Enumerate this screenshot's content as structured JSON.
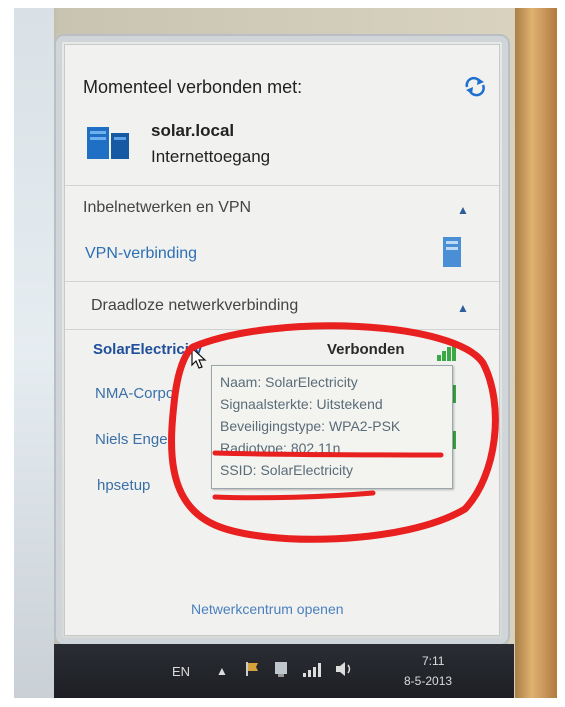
{
  "connected": {
    "heading": "Momenteel verbonden met:",
    "network_name": "solar.local",
    "access": "Internettoegang"
  },
  "sections": {
    "dialup": "Inbelnetwerken en VPN",
    "vpn": "VPN-verbinding",
    "wireless": "Draadloze netwerkverbinding"
  },
  "networks": [
    {
      "name": "SolarElectricity",
      "status": "Verbonden"
    },
    {
      "name": "NMA-Corpo"
    },
    {
      "name": "Niels Engel"
    },
    {
      "name": "hpsetup"
    }
  ],
  "tooltip": {
    "naam": "Naam: SolarElectricity",
    "signal": "Signaalsterkte: Uitstekend",
    "security": "Beveiligingstype: WPA2-PSK",
    "radio": "Radiotype: 802.11n",
    "ssid": "SSID: SolarElectricity"
  },
  "footer": {
    "open_center": "Netwerkcentrum openen"
  },
  "taskbar": {
    "lang": "EN",
    "time": "7:11",
    "date": "8-5-2013"
  },
  "colors": {
    "annotation": "#e8201f",
    "signal": "#39a845",
    "link": "#2d6fb6"
  }
}
